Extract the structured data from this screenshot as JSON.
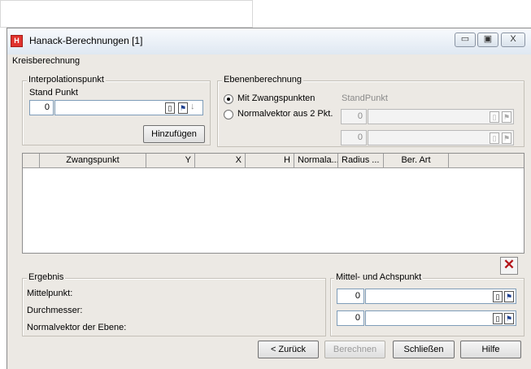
{
  "window": {
    "title": "Hanack-Berechnungen [1]",
    "controls": {
      "minimize": "▭",
      "maximize": "▣",
      "close": "X"
    }
  },
  "menu": {
    "label": "Kreisberechnung"
  },
  "interpolation": {
    "group_label": "Interpolationspunkt",
    "field_label": "Stand Punkt",
    "number": "0",
    "text": "",
    "add_button": "Hinzufügen"
  },
  "ebenen": {
    "group_label": "Ebenenberechnung",
    "options": [
      "Mit Zwangspunkten",
      "Normalvektor aus 2 Pkt."
    ],
    "selected": 0,
    "standpunkt_label": "StandPunkt",
    "field1_number": "0",
    "field2_number": "0"
  },
  "table": {
    "columns": [
      "Zwangspunkt",
      "Y",
      "X",
      "H",
      "Normala...",
      "Radius ...",
      "Ber. Art"
    ],
    "rows": []
  },
  "ergebnis": {
    "group_label": "Ergebnis",
    "lines": [
      "Mittelpunkt:",
      "Durchmesser:",
      "Normalvektor der Ebene:"
    ]
  },
  "mittel": {
    "group_label": "Mittel- und Achspunkt",
    "field1_number": "0",
    "field2_number": "0"
  },
  "buttons": {
    "back": "< Zurück",
    "calculate": "Berechnen",
    "close": "Schließen",
    "help": "Hilfe"
  },
  "colors": {
    "delete": "#b4161b",
    "app_icon": "#e0332e"
  },
  "icons": [
    "app-icon",
    "pick-point-icon",
    "select-icon",
    "arrow-down-icon",
    "delete-x-icon"
  ]
}
